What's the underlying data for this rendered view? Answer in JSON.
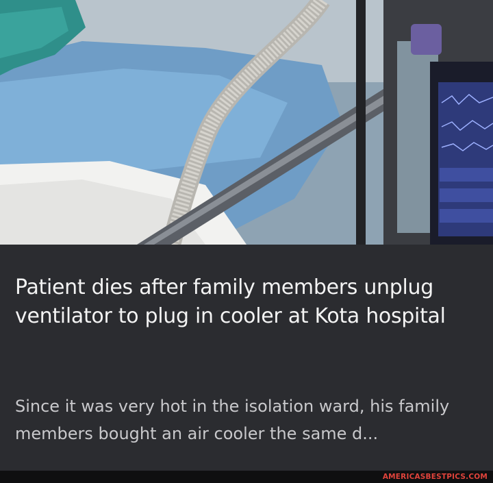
{
  "article": {
    "image_alt": "hospital-bed-ventilator-photo",
    "headline": "Patient dies after family members unplug ventilator to plug in cooler at Kota hospital",
    "snippet": "Since it was very hot in the isolation ward, his family members bought an air cooler the same d..."
  },
  "watermark": {
    "text": "AMERICASBESTPICS.COM"
  },
  "colors": {
    "panel_background": "#2b2c30",
    "headline_text": "#f3f3f3",
    "snippet_text": "#c9c9cc",
    "watermark": "#e0433b",
    "footer_bar": "#0f0f10"
  }
}
